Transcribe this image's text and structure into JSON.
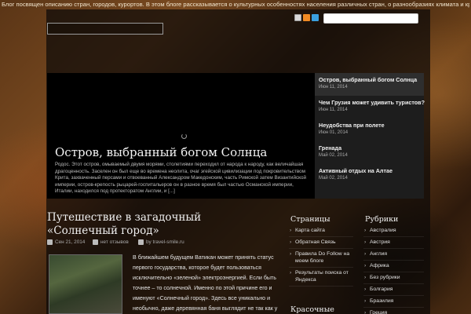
{
  "tagline": "Блог посвящен описанию стран, городов, курортов. В этом блоге рассказывается о культурных особенностях населения различных стран, о разнообразиях климата и красотах мира",
  "search": {
    "placeholder": ""
  },
  "social_icons": [
    "mail-icon",
    "rss-icon",
    "twitter-icon"
  ],
  "slider": {
    "title": "Остров, выбранный богом Солнца",
    "text": "Родос. Этот остров, омываемый двумя морями, столетиями переходил от народа к народу, как величайшая драгоценность. Заселен он был еще во времена неолита, очаг эгейской цивилизации под покровительством Крита, захваченный персами и отвоеванный Александром Македонским, часть Римской затем Византийской империи, остров-крепость рыцарей-госпитальеров он в разное время был частью Османской империи, Италии, находился под протекторатом Англии, и [...]",
    "items": [
      {
        "title": "Остров, выбранный богом Солнца",
        "date": "Июн 11, 2014"
      },
      {
        "title": "Чем Грузия может удивить туристов?",
        "date": "Июн 11, 2014"
      },
      {
        "title": "Неудобства при полете",
        "date": "Июн 01, 2014"
      },
      {
        "title": "Гренада",
        "date": "Май 02, 2014"
      },
      {
        "title": "Активный отдых на Алтае",
        "date": "Май 02, 2014"
      }
    ]
  },
  "post": {
    "title": "Путешествие в загадочный «Солнечный город»",
    "date": "Сен 21, 2014",
    "comments": "нет отзывов",
    "author": "by travel-smile.ru",
    "text": "В ближайшем будущем Ватикан может принять статус первого государства, которое будет пользоваться исключительно «зеленой» электроэнергией. Если быть точнее – то солнечной. Именно по этой причине его и именуют «Солнечный город». Здесь все уникально и необычно, даже деревянная баня выглядит не так как у нас, а поинему. В чем уникальность Ватикана как"
  },
  "pages_widget": {
    "title": "Страницы",
    "items": [
      "Карта сайта",
      "Обратная Связь",
      "Правила Do Follow на моем блоге",
      "Результаты поиска от Яндекса"
    ]
  },
  "second_widget": {
    "title": "Красочные"
  },
  "rubrics_widget": {
    "title": "Рубрики",
    "items": [
      "Австралия",
      "Австрия",
      "Англия",
      "Африка",
      "Без рубрики",
      "Болгария",
      "Бразилия",
      "Греция"
    ]
  }
}
